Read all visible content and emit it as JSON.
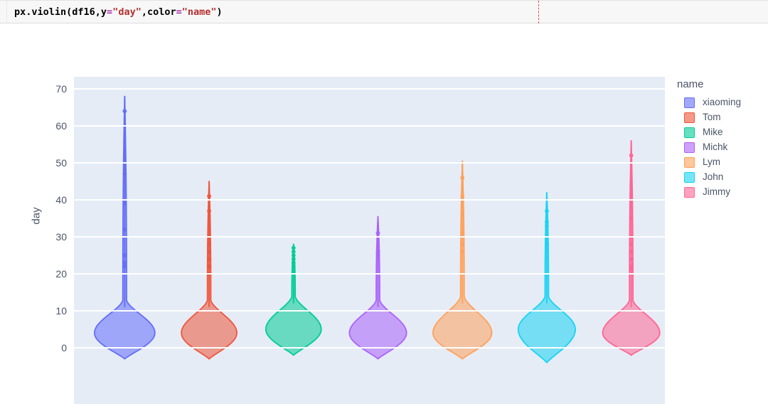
{
  "code_cell": {
    "tokens": [
      {
        "t": "px.violin(df16,y",
        "k": "plain"
      },
      {
        "t": "=",
        "k": "op"
      },
      {
        "t": "\"day\"",
        "k": "str"
      },
      {
        "t": ",color",
        "k": "plain"
      },
      {
        "t": "=",
        "k": "op"
      },
      {
        "t": "\"name\"",
        "k": "str"
      },
      {
        "t": ")",
        "k": "plain"
      }
    ],
    "text": "px.violin(df16,y=\"day\",color=\"name\")",
    "ruler_marker": "column-ruler"
  },
  "legend": {
    "title": "name",
    "items": [
      {
        "label": "xiaoming",
        "color": "#636EFA"
      },
      {
        "label": "Tom",
        "color": "#EF553B"
      },
      {
        "label": "Mike",
        "color": "#00CC96"
      },
      {
        "label": "Michk",
        "color": "#AB63FA"
      },
      {
        "label": "Lym",
        "color": "#FFA15A"
      },
      {
        "label": "John",
        "color": "#19D3F3"
      },
      {
        "label": "Jimmy",
        "color": "#FF6692"
      }
    ]
  },
  "axes": {
    "y_title": "day",
    "y_ticks": [
      0,
      10,
      20,
      30,
      40,
      50,
      60,
      70
    ],
    "y_range": [
      -7,
      73
    ],
    "x_title": ""
  },
  "theme": {
    "plot_bg": "#E5ECF6",
    "paper_bg": "#FFFFFF",
    "gridline": "#FFFFFF",
    "tick_text": "#4a5568"
  },
  "chart_data": {
    "type": "violin",
    "title": "",
    "xlabel": "",
    "ylabel": "day",
    "ylim": [
      -7,
      73
    ],
    "grid": true,
    "legend_position": "right",
    "legend_title": "name",
    "categories": [
      "xiaoming",
      "Tom",
      "Mike",
      "Michk",
      "Lym",
      "John",
      "Jimmy"
    ],
    "series": [
      {
        "name": "xiaoming",
        "color": "#636EFA",
        "min": -3,
        "max": 68,
        "median": 4,
        "mode": 4,
        "body_top": 13,
        "tail_top": 68,
        "max_halfwidth_units": 0.36,
        "points": [
          64,
          47,
          39,
          32,
          25,
          23,
          22
        ]
      },
      {
        "name": "Tom",
        "color": "#EF553B",
        "min": -3,
        "max": 45,
        "median": 4,
        "mode": 4,
        "body_top": 13,
        "tail_top": 45,
        "max_halfwidth_units": 0.33,
        "points": [
          41,
          37,
          28,
          26,
          24,
          22,
          20
        ]
      },
      {
        "name": "Mike",
        "color": "#00CC96",
        "min": -2,
        "max": 28,
        "median": 5,
        "mode": 5,
        "body_top": 14,
        "tail_top": 28,
        "max_halfwidth_units": 0.33,
        "points": [
          27,
          26,
          25,
          24,
          23,
          22
        ]
      },
      {
        "name": "Michk",
        "color": "#AB63FA",
        "min": -3,
        "max": 35.5,
        "median": 4,
        "mode": 4,
        "body_top": 13,
        "tail_top": 35.5,
        "max_halfwidth_units": 0.34,
        "points": [
          31,
          26,
          25
        ]
      },
      {
        "name": "Lym",
        "color": "#FFA15A",
        "min": -3,
        "max": 50.5,
        "median": 4,
        "mode": 4,
        "body_top": 14,
        "tail_top": 50.5,
        "max_halfwidth_units": 0.35,
        "points": [
          46,
          41,
          36,
          31,
          28,
          26
        ]
      },
      {
        "name": "John",
        "color": "#19D3F3",
        "min": -4,
        "max": 42,
        "median": 5,
        "mode": 5,
        "body_top": 14,
        "tail_top": 42,
        "max_halfwidth_units": 0.34,
        "points": [
          37,
          34,
          33,
          28
        ]
      },
      {
        "name": "Jimmy",
        "color": "#FF6692",
        "min": -2,
        "max": 56,
        "median": 4,
        "mode": 4,
        "body_top": 13,
        "tail_top": 56,
        "max_halfwidth_units": 0.34,
        "points": [
          52,
          35,
          30,
          28,
          26,
          24,
          22,
          21
        ]
      }
    ]
  }
}
